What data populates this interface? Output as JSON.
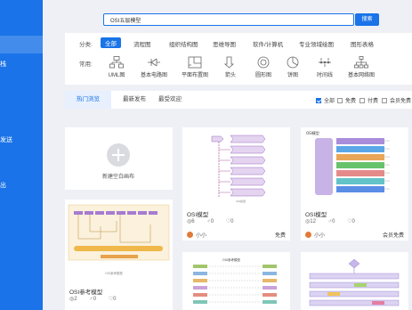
{
  "sidebar": {
    "items": [
      {
        "label": ""
      },
      {
        "label": "栈"
      },
      {
        "label": "发送"
      },
      {
        "label": "出"
      }
    ]
  },
  "search": {
    "value": "OSI五层模型",
    "placeholder": "",
    "button_label": "搜索"
  },
  "filters": {
    "category_label": "分类:",
    "categories": [
      "全部",
      "流程图",
      "组织结构图",
      "思维导图",
      "软件/计算机",
      "专业领域绘图",
      "图形表格"
    ],
    "common_label": "常用:",
    "common_items": [
      {
        "label": "UML图",
        "icon": "uml-icon"
      },
      {
        "label": "基本电路图",
        "icon": "circuit-icon"
      },
      {
        "label": "平面布置图",
        "icon": "floorplan-icon"
      },
      {
        "label": "箭头",
        "icon": "arrow-icon"
      },
      {
        "label": "圆形图",
        "icon": "circle-chart-icon"
      },
      {
        "label": "饼图",
        "icon": "pie-icon"
      },
      {
        "label": "时间线",
        "icon": "timeline-icon"
      },
      {
        "label": "基本网络图",
        "icon": "network-icon"
      }
    ]
  },
  "tabs": {
    "items": [
      "热门浏览",
      "最新发布",
      "最受欢迎"
    ],
    "checkboxes": [
      {
        "label": "全部",
        "checked": true
      },
      {
        "label": "免费",
        "checked": false
      },
      {
        "label": "付费",
        "checked": false
      },
      {
        "label": "会员免费",
        "checked": false
      }
    ]
  },
  "cards": {
    "new_blank": {
      "label": "新建空白画布"
    },
    "items": [
      {
        "title": "OSI模型",
        "views": "6",
        "likes": "0",
        "comments": "0",
        "author": "小小",
        "tag": "免费"
      },
      {
        "title": "OSI模型",
        "views": "12",
        "likes": "0",
        "comments": "0",
        "author": "小小",
        "tag": "会员免费"
      },
      {
        "title": "OSI参考模型",
        "views": "2",
        "likes": "0",
        "comments": "0",
        "author": "",
        "tag": ""
      },
      {
        "title": "",
        "views": "",
        "likes": "",
        "comments": "",
        "author": "",
        "tag": ""
      },
      {
        "title": "",
        "views": "",
        "likes": "",
        "comments": "",
        "author": "",
        "tag": ""
      }
    ],
    "thumb_texts": [
      "OSI模型",
      "OSI参考模型"
    ]
  },
  "colors": {
    "accent": "#1a73e8",
    "sidebar": "#1a73e8",
    "background": "#eef0f5"
  }
}
